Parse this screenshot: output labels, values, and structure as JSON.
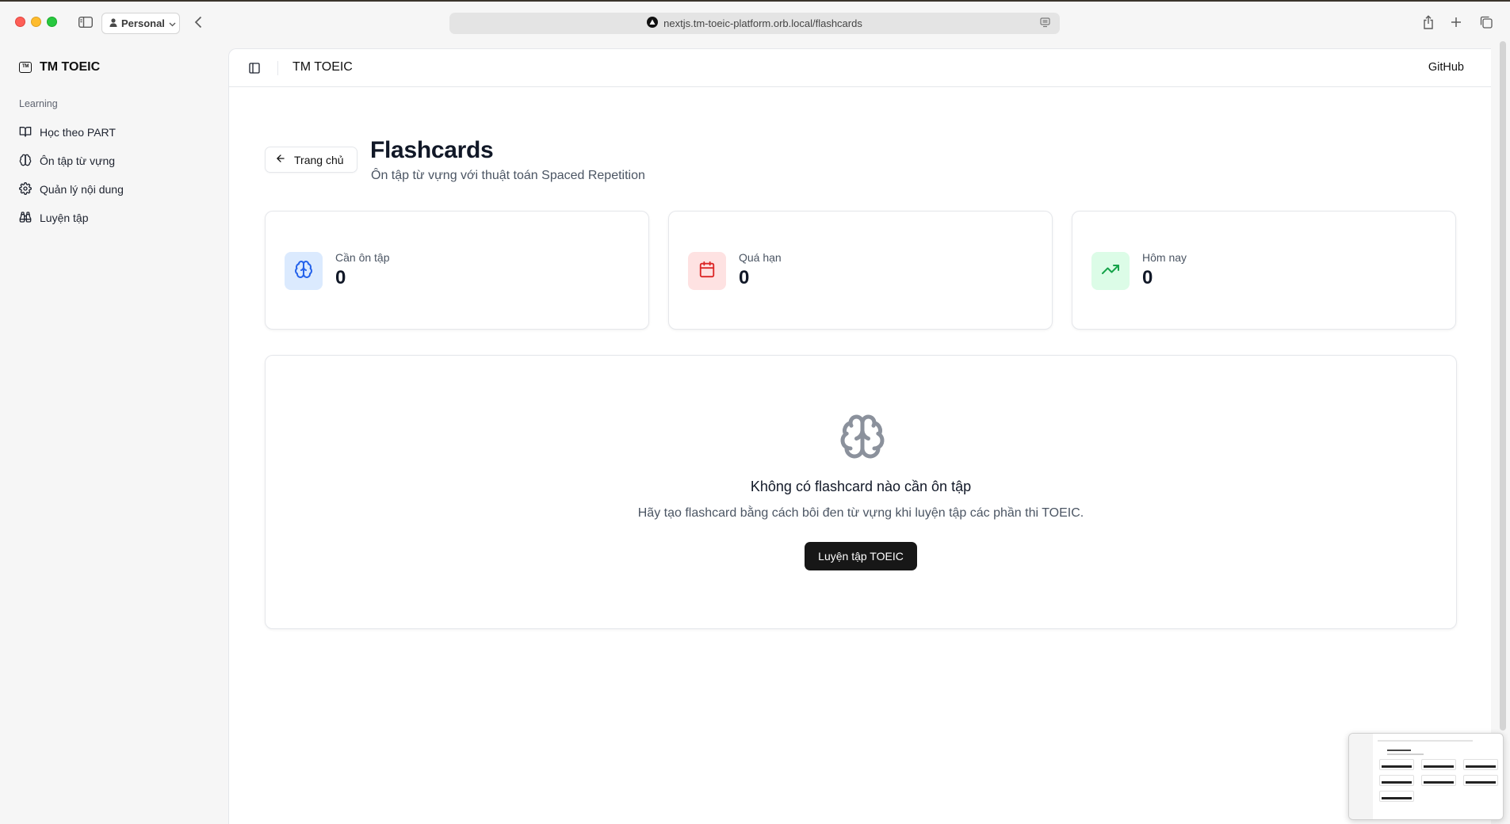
{
  "browser": {
    "profile_label": "Personal",
    "url": "nextjs.tm-toeic-platform.orb.local/flashcards"
  },
  "sidebar": {
    "brand": "TM TOEIC",
    "brand_mark": "TM",
    "group_label": "Learning",
    "items": [
      {
        "label": "Học theo PART",
        "icon": "book-open-icon"
      },
      {
        "label": "Ôn tập từ vựng",
        "icon": "brain-icon"
      },
      {
        "label": "Quản lý nội dung",
        "icon": "gear-icon"
      },
      {
        "label": "Luyện tập",
        "icon": "binoculars-icon"
      }
    ]
  },
  "header": {
    "title": "TM TOEIC",
    "github_label": "GitHub"
  },
  "page": {
    "back_label": "Trang chủ",
    "title": "Flashcards",
    "subtitle": "Ôn tập từ vựng với thuật toán Spaced Repetition"
  },
  "stats": [
    {
      "label": "Cần ôn tập",
      "value": "0",
      "icon": "brain-icon",
      "color": "#2563eb",
      "bg": "#dbeafe"
    },
    {
      "label": "Quá hạn",
      "value": "0",
      "icon": "calendar-icon",
      "color": "#dc2626",
      "bg": "#fee2e2"
    },
    {
      "label": "Hôm nay",
      "value": "0",
      "icon": "trending-up-icon",
      "color": "#16a34a",
      "bg": "#dcfce7"
    }
  ],
  "empty_state": {
    "icon": "brain-icon",
    "title": "Không có flashcard nào cần ôn tập",
    "description": "Hãy tạo flashcard bằng cách bôi đen từ vựng khi luyện tập các phần thi TOEIC.",
    "cta_label": "Luyện tập TOEIC"
  },
  "colors": {
    "primary_button": "#171717",
    "text_muted": "#4b5563"
  }
}
